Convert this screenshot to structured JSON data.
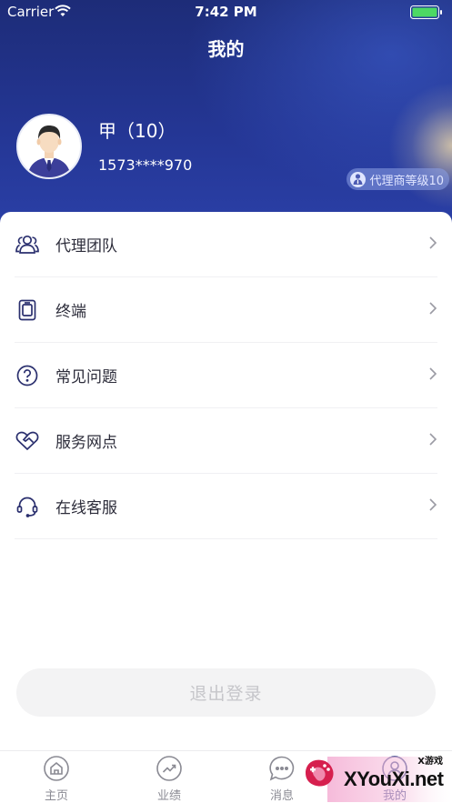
{
  "status_bar": {
    "carrier": "Carrier",
    "time": "7:42 PM"
  },
  "page_title": "我的",
  "profile": {
    "name": "甲（10）",
    "phone": "1573****970",
    "level": "代理商等级10"
  },
  "menu": [
    {
      "label": "代理团队",
      "icon": "team-icon"
    },
    {
      "label": "终端",
      "icon": "terminal-icon"
    },
    {
      "label": "常见问题",
      "icon": "question-icon"
    },
    {
      "label": "服务网点",
      "icon": "heart-handshake-icon"
    },
    {
      "label": "在线客服",
      "icon": "headset-icon"
    }
  ],
  "logout_label": "退出登录",
  "tabs": [
    {
      "label": "主页",
      "icon": "home-icon",
      "active": false
    },
    {
      "label": "业绩",
      "icon": "trend-icon",
      "active": false
    },
    {
      "label": "消息",
      "icon": "message-icon",
      "active": false
    },
    {
      "label": "我的",
      "icon": "profile-icon",
      "active": true
    }
  ],
  "watermark": {
    "text": "XYouXi.net",
    "small": "X游戏"
  },
  "colors": {
    "header_dark": "#1d2c78",
    "header_light": "#2b40a8",
    "icon_stroke": "#2a2f6e",
    "logout_bg": "#f3f3f4",
    "tab_active": "#27307d"
  }
}
